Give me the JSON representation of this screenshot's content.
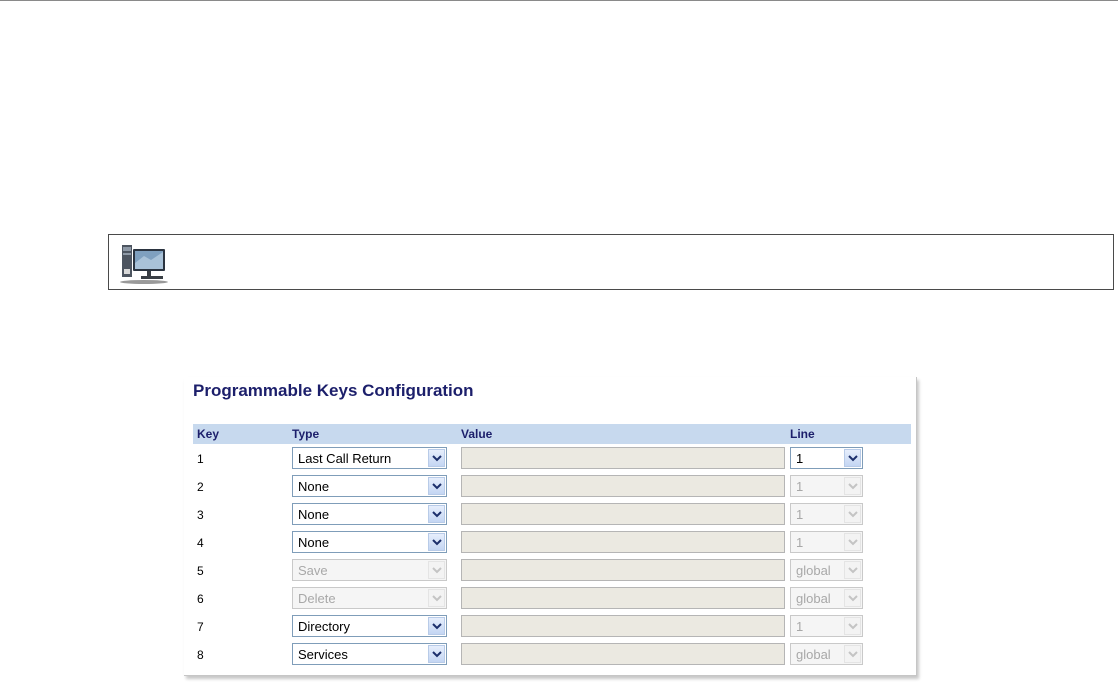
{
  "panel": {
    "title": "Programmable Keys Configuration",
    "columns": {
      "key": "Key",
      "type": "Type",
      "value": "Value",
      "line": "Line"
    }
  },
  "rows": [
    {
      "key": "1",
      "type": "Last Call Return",
      "type_enabled": true,
      "value": "",
      "line": "1",
      "line_enabled": true
    },
    {
      "key": "2",
      "type": "None",
      "type_enabled": true,
      "value": "",
      "line": "1",
      "line_enabled": false
    },
    {
      "key": "3",
      "type": "None",
      "type_enabled": true,
      "value": "",
      "line": "1",
      "line_enabled": false
    },
    {
      "key": "4",
      "type": "None",
      "type_enabled": true,
      "value": "",
      "line": "1",
      "line_enabled": false
    },
    {
      "key": "5",
      "type": "Save",
      "type_enabled": false,
      "value": "",
      "line": "global",
      "line_enabled": false
    },
    {
      "key": "6",
      "type": "Delete",
      "type_enabled": false,
      "value": "",
      "line": "global",
      "line_enabled": false
    },
    {
      "key": "7",
      "type": "Directory",
      "type_enabled": true,
      "value": "",
      "line": "1",
      "line_enabled": false
    },
    {
      "key": "8",
      "type": "Services",
      "type_enabled": true,
      "value": "",
      "line": "global",
      "line_enabled": false
    }
  ],
  "icons": {
    "tip": "desktop-computer-icon",
    "dropdown": "chevron-down-icon"
  },
  "colors": {
    "title": "#1c1f6b",
    "header_bg": "#c7d9ee",
    "disabled_text": "#a8a8a8"
  }
}
